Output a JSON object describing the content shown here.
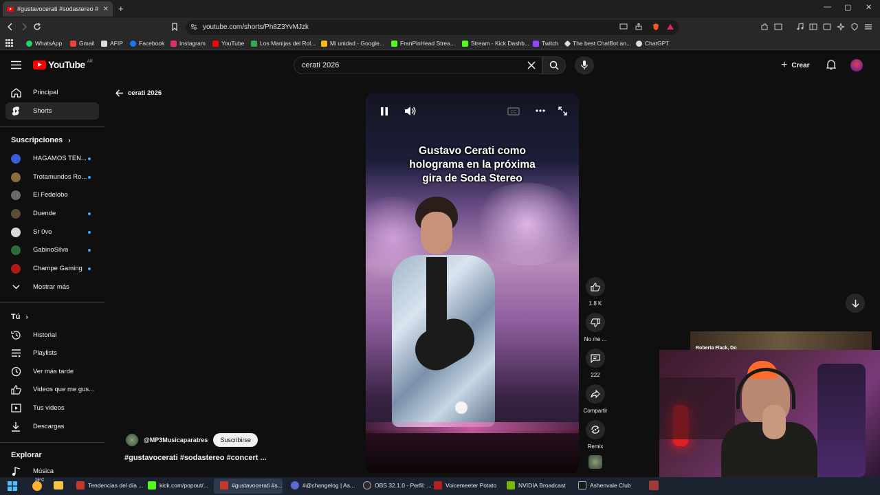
{
  "browser": {
    "tab_title": "#gustavocerati #sodastereo #",
    "url": "youtube.com/shorts/Ph8Z3YvMJzk",
    "bookmarks": [
      "WhatsApp",
      "Gmail",
      "AFIP",
      "Facebook",
      "Instagram",
      "YouTube",
      "Los Manijas del Rol...",
      "Mi unidad - Google...",
      "FranPinHead Strea...",
      "Stream - Kick Dashb...",
      "Twitch",
      "The best ChatBot an...",
      "ChatGPT"
    ]
  },
  "youtube": {
    "logo_text": "YouTube",
    "region": "AR",
    "search_value": "cerati 2026",
    "create_label": "Crear",
    "back_label": "cerati 2026"
  },
  "sidebar": {
    "main": [
      {
        "label": "Principal",
        "icon": "home-icon"
      },
      {
        "label": "Shorts",
        "icon": "shorts-icon"
      }
    ],
    "subs_title": "Suscripciones",
    "subs": [
      {
        "label": "HAGAMOS TEN...",
        "color": "#3b5bd6"
      },
      {
        "label": "Trotamundos Ro...",
        "color": "#8a6d3b"
      },
      {
        "label": "El Fedelobo",
        "color": "#6a6a6a"
      },
      {
        "label": "Duende",
        "color": "#5a4a3a"
      },
      {
        "label": "Sr 0vo",
        "color": "#d8d8d8"
      },
      {
        "label": "GabinoSilva",
        "color": "#2e6b3a"
      },
      {
        "label": "Champe Gaming",
        "color": "#b01818"
      }
    ],
    "more_label": "Mostrar más",
    "you_title": "Tú",
    "you": [
      {
        "label": "Historial",
        "icon": "history-icon"
      },
      {
        "label": "Playlists",
        "icon": "playlists-icon"
      },
      {
        "label": "Ver más tarde",
        "icon": "watch-later-icon"
      },
      {
        "label": "Videos que me gus...",
        "icon": "liked-icon"
      },
      {
        "label": "Tus videos",
        "icon": "your-videos-icon"
      },
      {
        "label": "Descargas",
        "icon": "downloads-icon"
      }
    ],
    "explore_title": "Explorar",
    "explore": [
      {
        "label": "Música",
        "icon": "music-icon"
      }
    ]
  },
  "short": {
    "caption_lines": [
      "Gustavo Cerati como",
      "holograma en la próxima",
      "gira de Soda Stereo"
    ],
    "channel": "@MP3Musicaparatres",
    "subscribe_label": "Suscribirse",
    "title": "#gustavocerati #sodastereo #concert ...",
    "likes": "1.8 K",
    "dislike_label": "No me ...",
    "comments": "222",
    "share_label": "Compartir",
    "remix_label": "Remix"
  },
  "webcam": {
    "overlay_text": "Roberta Flack, Do"
  },
  "taskbar": {
    "weather": "26°C",
    "items": [
      {
        "label": "Tendencias del día ...",
        "color": "#c0392b"
      },
      {
        "label": "kick.com/popout/...",
        "color": "#53fc18"
      },
      {
        "label": "#gustavocerati #s...",
        "color": "#c0392b"
      },
      {
        "label": "#@changelog | As...",
        "color": "#5a6ad6"
      },
      {
        "label": "OBS 32.1.0 - Perfil: ...",
        "color": "#2a2a2a"
      },
      {
        "label": "Voicemeeter Potato",
        "color": "#b82020"
      },
      {
        "label": "NVIDIA Broadcast",
        "color": "#76b900"
      },
      {
        "label": "Ashenvale Club",
        "color": "#1a1a1a"
      }
    ]
  }
}
